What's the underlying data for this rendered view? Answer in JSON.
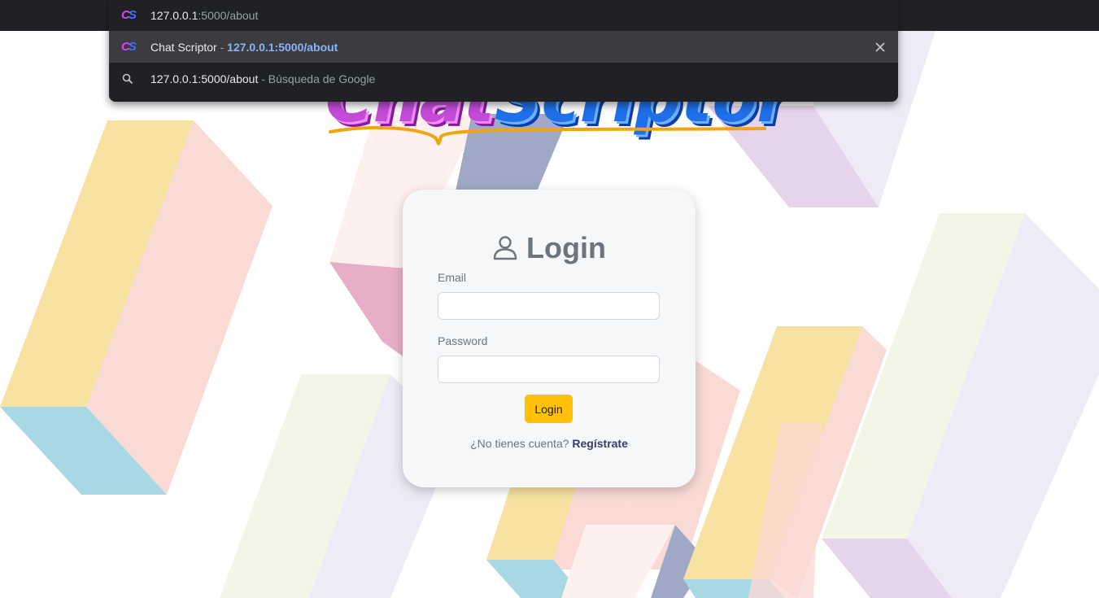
{
  "browser": {
    "omnibox": {
      "input_host": "127.0.0.1",
      "input_path": ":5000/about",
      "suggestions": [
        {
          "title": "Chat Scriptor",
          "separator": " - ",
          "url": "127.0.0.1:5000/about",
          "icon": "site-favicon",
          "close_icon": "close-icon"
        },
        {
          "query": "127.0.0.1:5000/about",
          "separator": " - ",
          "description": "Búsqueda de Google",
          "icon": "search-icon"
        }
      ],
      "favicon_letters": {
        "c": "C",
        "s": "S"
      }
    }
  },
  "logo": {
    "part1": "Chat",
    "part2": "Scriptor"
  },
  "login_card": {
    "title": "Login",
    "title_icon": "user-icon",
    "email_label": "Email",
    "email_value": "",
    "password_label": "Password",
    "password_value": "",
    "submit_label": "Login",
    "register_prompt": "¿No tienes cuenta?",
    "register_link": "Regístrate"
  },
  "colors": {
    "accent_button": "#ffc107",
    "link": "#3a3a6e",
    "card_bg": "#f6f7f9",
    "url_highlight": "#8ab4f8"
  }
}
